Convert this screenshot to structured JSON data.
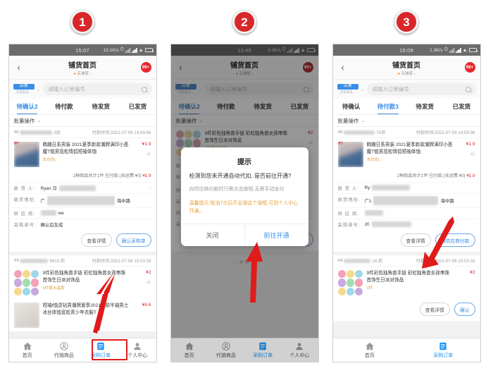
{
  "steps": [
    {
      "number": "1"
    },
    {
      "number": "2"
    },
    {
      "number": "3"
    }
  ],
  "screens": [
    {
      "id": "screen-1",
      "status": {
        "time": "15:07",
        "speed": "13.1K/s",
        "alarm_icon": "alarm-icon",
        "signal_icon": "signal-bars-icon",
        "wifi_icon": "wifi-icon",
        "battery_icon": "battery-icon"
      },
      "nav": {
        "back_icon": "back-chevron-icon",
        "title": "铺货首页",
        "subtitle": "店铺家",
        "badge": "99+"
      },
      "search": {
        "chip_label": "店铺",
        "chip_sub": "店管家电...",
        "chevron_icon": "chevron-down-icon",
        "placeholder": "请输入订单编号",
        "icon": "search-icon"
      },
      "tabs": [
        {
          "label": "待确认2",
          "active": true
        },
        {
          "label": "待付款",
          "active": false
        },
        {
          "label": "待发货",
          "active": false
        },
        {
          "label": "已发货",
          "active": false
        }
      ],
      "batch": {
        "label": "批量操作",
        "chevron_icon": "chevron-down-icon"
      },
      "cards": [
        {
          "order_prefix": "46",
          "order_suffix": "3后",
          "pay_time": "付款时间:2021-07-09 14:59:56",
          "items": [
            {
              "title": "韩趣日系男装 2021夏季新款潮牌满印小恶魔T恤男宽松情侣短袖体恤",
              "spec": "本白色L",
              "price": "¥1.9",
              "qty": "x1",
              "thumb": "tshirt"
            }
          ],
          "summary_text": "1种商品共计1件 已付款:(含运费:¥0)",
          "summary_amount": "¥1.9",
          "info": [
            {
              "label": "收 货 人:",
              "value": "Ryan 冯",
              "masked": true
            },
            {
              "label": "收货地址:",
              "value": "广",
              "value_tail": "海中路",
              "masked": true
            },
            {
              "label": "供 应 商:",
              "value": "we",
              "masked": true
            },
            {
              "label": "采购单号:",
              "value": "确认后生成",
              "masked": false
            }
          ],
          "buttons": [
            {
              "label": "查看详情",
              "primary": false
            },
            {
              "label": "确认采购单",
              "primary": true
            }
          ]
        },
        {
          "order_prefix": "44",
          "order_suffix": "9918 后",
          "pay_time": "付款时间:2021-07-06 15:03:33",
          "items": [
            {
              "title": "9件彩色独角兽手链 彩虹独角兽女孩串珠首饰生日派对饰品",
              "spec": "9件套水晶款",
              "price": "¥2",
              "qty": "x1",
              "thumb": "unicorn"
            },
            {
              "title": "短袖t恤烫钻男潮牌夏季2021新款半袖男士冰丝体恤宽松青少年衣服T",
              "spec": "",
              "price": "¥6.6",
              "qty": "",
              "thumb": "plain"
            }
          ],
          "summary_text": "",
          "summary_amount": "",
          "info": [],
          "buttons": []
        }
      ],
      "tabbar": [
        {
          "label": "首页",
          "icon": "home-icon",
          "active": false
        },
        {
          "label": "代销商品",
          "icon": "goods-icon",
          "active": false
        },
        {
          "label": "采购订单",
          "icon": "orders-icon",
          "active": true
        },
        {
          "label": "个人中心",
          "icon": "person-icon",
          "active": false
        }
      ],
      "annotations": {
        "arrow": "red-arrow-up",
        "redbox": "red-highlight-box"
      }
    },
    {
      "id": "screen-2",
      "status": {
        "time": "13:45",
        "speed": "3.3K/s",
        "alarm_icon": "alarm-icon",
        "signal_icon": "signal-bars-icon",
        "wifi_icon": "wifi-icon",
        "battery_icon": "battery-icon"
      },
      "nav": {
        "back_icon": "back-chevron-icon",
        "title": "铺货首页",
        "subtitle": "店铺家",
        "badge": "99+"
      },
      "search": {
        "chip_label": "店铺",
        "chip_sub": "店管家电...",
        "chevron_icon": "chevron-down-icon",
        "placeholder": "请输入订单编号",
        "icon": "search-icon"
      },
      "tabs": [
        {
          "label": "待确认2",
          "active": true
        },
        {
          "label": "待付款",
          "active": false
        },
        {
          "label": "待发货",
          "active": false
        },
        {
          "label": "已发货",
          "active": false
        }
      ],
      "batch": {
        "label": "批量操作",
        "chevron_icon": "chevron-down-icon"
      },
      "cards": [
        {
          "order_prefix": "",
          "order_suffix": "",
          "pay_time": "",
          "items": [
            {
              "title": "9件彩色独角兽手链 彩虹独角兽女孩串珠首饰生日派对饰品",
              "spec": "9件套水晶款",
              "price": "¥2",
              "qty": "x1",
              "thumb": "unicorn"
            }
          ],
          "summary_text": "",
          "summary_amount": "",
          "info": [
            {
              "label": "收 货 人:",
              "value": "",
              "masked": true
            },
            {
              "label": "收货地址:",
              "value": "",
              "masked": true
            },
            {
              "label": "供 应 商:",
              "value": "",
              "masked": true
            },
            {
              "label": "采购单号:",
              "value": "2",
              "masked": true
            },
            {
              "label": "供 应 商:",
              "value": "R",
              "value_tail": "厂G",
              "masked": true
            },
            {
              "label": "采购单号:",
              "value": "确认后生成",
              "masked": false
            }
          ],
          "buttons": [
            {
              "label": "查看详情",
              "primary": false
            },
            {
              "label": "确认采购单",
              "primary": true
            }
          ]
        }
      ],
      "more_label": "----更多----",
      "modal": {
        "title": "提示",
        "question": "检测到您未开通自动代扣, 是否前往开通?",
        "paragraph": "向供应商付款时只需点击按钮,无需手动支付",
        "warning": "温馨提示:取消7次后不会弹这个弹框,可到个人中心开通。",
        "buttons": [
          {
            "label": "关闭",
            "primary": false
          },
          {
            "label": "前往开通",
            "primary": true
          }
        ]
      },
      "tabbar": [
        {
          "label": "首页",
          "icon": "home-icon",
          "active": false
        },
        {
          "label": "代销商品",
          "icon": "goods-icon",
          "active": false
        },
        {
          "label": "采购订单",
          "icon": "orders-icon",
          "active": true
        },
        {
          "label": "个人中心",
          "icon": "person-icon",
          "active": false
        }
      ],
      "annotations": {
        "arrow": "red-arrow-up"
      }
    },
    {
      "id": "screen-3",
      "status": {
        "time": "15:09",
        "speed": "1.3K/s",
        "alarm_icon": "alarm-icon",
        "signal_icon": "signal-bars-icon",
        "wifi_icon": "wifi-icon",
        "battery_icon": "battery-icon"
      },
      "nav": {
        "back_icon": "back-chevron-icon",
        "title": "铺货首页",
        "subtitle": "店铺家",
        "badge": "99+"
      },
      "search": {
        "chip_label": "店铺",
        "chip_sub": "店管家电...",
        "chevron_icon": "chevron-down-icon",
        "placeholder": "请输入订单编号",
        "icon": "search-icon"
      },
      "tabs": [
        {
          "label": "待确认",
          "active": false
        },
        {
          "label": "待付款3",
          "active": true
        },
        {
          "label": "待发货",
          "active": false
        },
        {
          "label": "已发货",
          "active": false
        }
      ],
      "batch": {
        "label": "批量操作",
        "chevron_icon": "chevron-down-icon"
      },
      "cards": [
        {
          "order_prefix": "48",
          "order_suffix": "70后",
          "pay_time": "付款时间:2021-07-09 14:59:56",
          "items": [
            {
              "title": "韩趣日系男装 2021夏季新款潮牌满印小恶魔T恤男宽松情侣短袖体恤",
              "spec": "本白色L",
              "price": "¥1.9",
              "qty": "x1",
              "thumb": "tshirt"
            }
          ],
          "summary_text": "1种商品共计1件 已付款:(含运费:¥0)",
          "summary_amount": "¥1.9",
          "info": [
            {
              "label": "收 货 人:",
              "value": "Ry",
              "masked": true
            },
            {
              "label": "收货地址:",
              "value": "广1",
              "value_tail": "海中路",
              "masked": true
            },
            {
              "label": "供 应 商:",
              "value": "",
              "masked": true
            },
            {
              "label": "采购单号:",
              "value": "20",
              "masked": true
            }
          ],
          "buttons": [
            {
              "label": "查看详情",
              "primary": false
            },
            {
              "label": "向供应商付款",
              "primary": true
            }
          ]
        },
        {
          "order_prefix": "44",
          "order_suffix": "16 后",
          "pay_time": "付款时间:2021-07-06 15:03:33",
          "items": [
            {
              "title": "9件彩色独角兽手链 彩虹独角兽女孩串珠首饰生日派对饰品",
              "spec": "9件",
              "price": "¥2",
              "qty": "",
              "thumb": "unicorn"
            }
          ],
          "summary_text": "",
          "summary_amount": "",
          "info": [],
          "buttons": [
            {
              "label": "查看详情",
              "primary": false
            },
            {
              "label": "确认",
              "primary": true
            }
          ]
        }
      ],
      "tabbar": [
        {
          "label": "首页",
          "icon": "home-icon",
          "active": false
        },
        {
          "label": "采购订单",
          "icon": "orders-icon",
          "active": true
        }
      ],
      "annotations": {
        "arrow": "red-arrow-down"
      }
    }
  ],
  "colors": {
    "accent_blue": "#3a8ee6",
    "accent_red": "#d9262a",
    "warn_orange": "#e6a23c",
    "annotation_red": "#e01b1b",
    "statusbar_grey": "#6b6b6b"
  }
}
